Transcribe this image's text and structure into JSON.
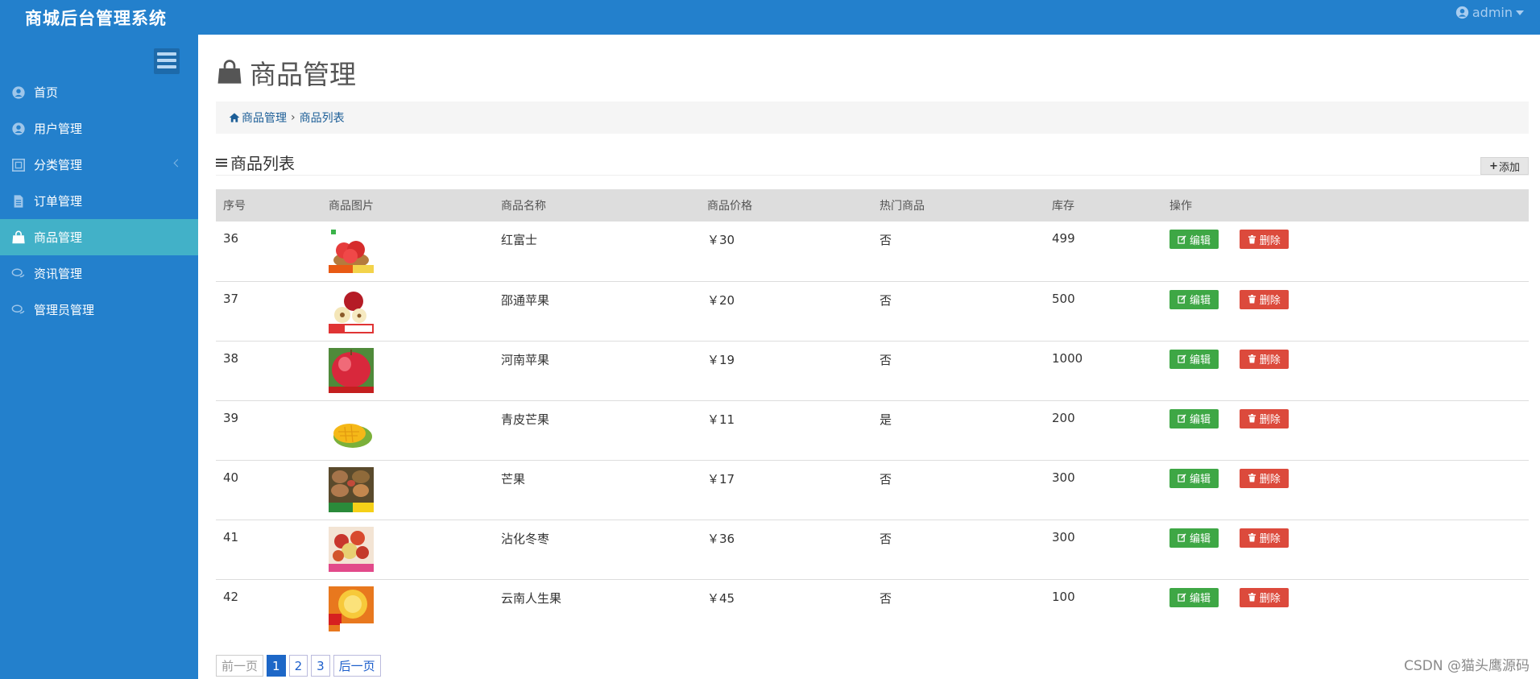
{
  "app": {
    "title": "商城后台管理系统",
    "user": "admin"
  },
  "sidebar": {
    "items": [
      {
        "label": "首页",
        "icon": "user-circle-icon"
      },
      {
        "label": "用户管理",
        "icon": "user-circle-icon"
      },
      {
        "label": "分类管理",
        "icon": "category-icon"
      },
      {
        "label": "订单管理",
        "icon": "document-icon"
      },
      {
        "label": "商品管理",
        "icon": "shopping-bag-icon",
        "active": true
      },
      {
        "label": "资讯管理",
        "icon": "chat-icon"
      },
      {
        "label": "管理员管理",
        "icon": "chat-icon"
      }
    ]
  },
  "page": {
    "title": "商品管理",
    "breadcrumb": {
      "root": "商品管理",
      "sep": "›",
      "current": "商品列表"
    },
    "section_title": "商品列表",
    "add_label": "添加"
  },
  "table": {
    "headers": [
      "序号",
      "商品图片",
      "商品名称",
      "商品价格",
      "热门商品",
      "库存",
      "操作"
    ],
    "edit_label": "编辑",
    "delete_label": "删除",
    "rows": [
      {
        "id": "36",
        "name": "红富士",
        "price": "￥30",
        "hot": "否",
        "stock": "499",
        "img": "red-apple-basket"
      },
      {
        "id": "37",
        "name": "邵通苹果",
        "price": "￥20",
        "hot": "否",
        "stock": "500",
        "img": "apple-halves"
      },
      {
        "id": "38",
        "name": "河南苹果",
        "price": "￥19",
        "hot": "否",
        "stock": "1000",
        "img": "red-apple-closeup"
      },
      {
        "id": "39",
        "name": "青皮芒果",
        "price": "￥11",
        "hot": "是",
        "stock": "200",
        "img": "cut-mango"
      },
      {
        "id": "40",
        "name": "芒果",
        "price": "￥17",
        "hot": "否",
        "stock": "300",
        "img": "mango-box"
      },
      {
        "id": "41",
        "name": "沾化冬枣",
        "price": "￥36",
        "hot": "否",
        "stock": "300",
        "img": "winter-jujube"
      },
      {
        "id": "42",
        "name": "云南人生果",
        "price": "￥45",
        "hot": "否",
        "stock": "100",
        "img": "yellow-fruit"
      }
    ]
  },
  "pager": {
    "prev": "前一页",
    "pages": [
      "1",
      "2",
      "3"
    ],
    "current": "1",
    "next": "后一页"
  },
  "watermark": "CSDN @猫头鹰源码",
  "colors": {
    "primary": "#2380cc",
    "active": "#42b1c8",
    "edit": "#3ea745",
    "delete": "#dc4a3c",
    "hot": "#e02020"
  }
}
